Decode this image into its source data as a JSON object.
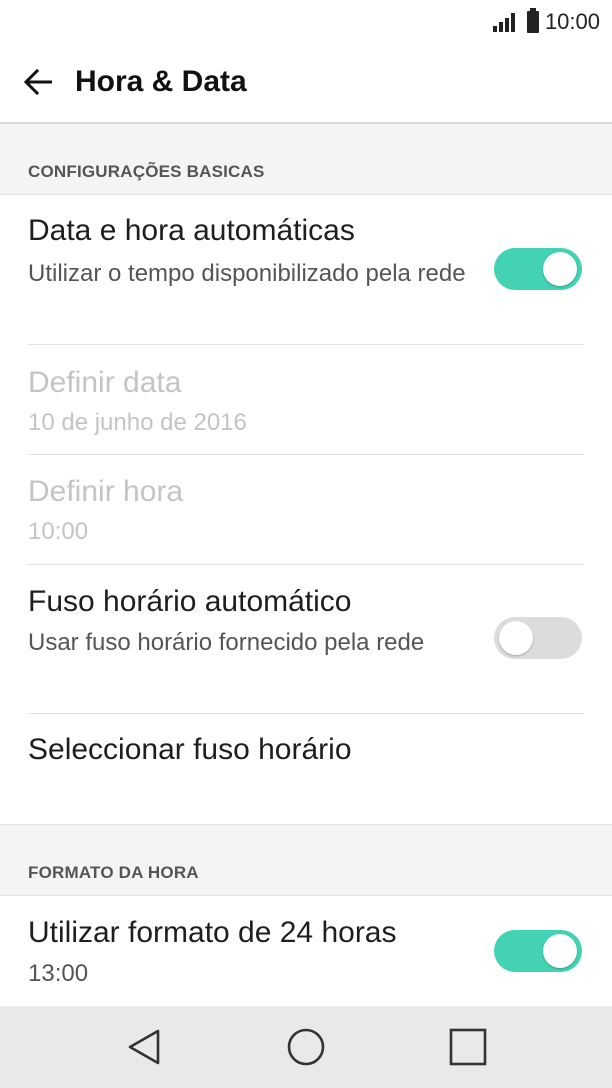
{
  "status_bar": {
    "time": "10:00",
    "signal_icon": "signal-icon",
    "battery_icon": "battery-icon"
  },
  "toolbar": {
    "back_icon": "arrow-left-icon",
    "title": "Hora & Data"
  },
  "sections": {
    "basic": {
      "header": "CONFIGURAÇÕES BASICAS",
      "auto_datetime": {
        "title": "Data e hora automáticas",
        "subtitle": "Utilizar o tempo disponibilizado pela rede",
        "enabled": true
      },
      "set_date": {
        "title": "Definir data",
        "value": "10 de junho de 2016"
      },
      "set_time": {
        "title": "Definir hora",
        "value": "10:00"
      },
      "auto_timezone": {
        "title": "Fuso horário automático",
        "subtitle": "Usar fuso horário fornecido pela rede",
        "enabled": false
      },
      "select_timezone": {
        "title": "Seleccionar fuso horário"
      }
    },
    "time_format": {
      "header": "FORMATO DA HORA",
      "use_24h": {
        "title": "Utilizar formato de 24 horas",
        "subtitle": "13:00",
        "enabled": true
      }
    }
  },
  "nav_bar": {
    "back_icon": "triangle-back-icon",
    "home_icon": "circle-home-icon",
    "recents_icon": "square-recents-icon"
  },
  "colors": {
    "toggle_on": "#43d3b3",
    "toggle_off": "#dcdcdc",
    "disabled_text": "#c4c4c4"
  }
}
